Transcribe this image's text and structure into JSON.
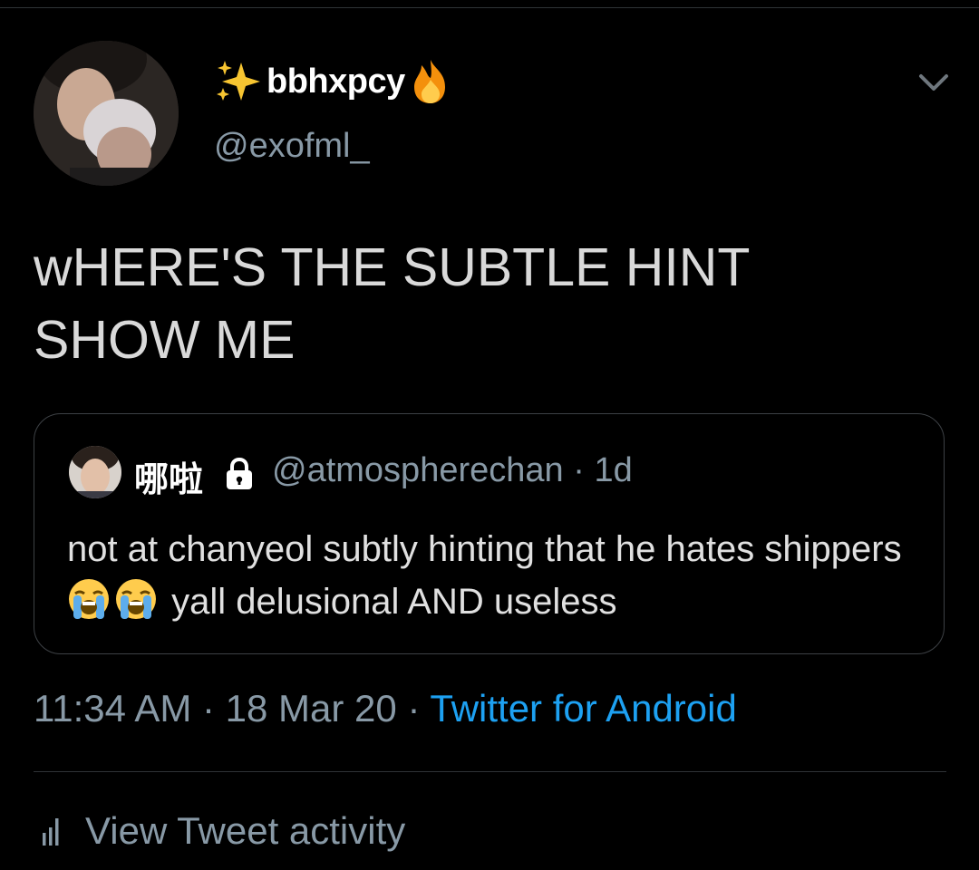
{
  "tweet": {
    "name_prefix_emoji": "sparkles",
    "display_name": "bbhxpcy",
    "name_suffix_emoji": "fire",
    "handle": "@exofml_",
    "text_line1": "wHERE'S THE SUBTLE HINT",
    "text_line2": "SHOW ME",
    "time": "11:34 AM",
    "date": "18 Mar 20",
    "source": "Twitter for Android"
  },
  "quote": {
    "display_name": "哪啦",
    "handle": "@atmospherechan",
    "age": "1d",
    "text_part1": "not at chanyeol subtly hinting that he hates shippers",
    "text_part2": "yall delusional AND useless",
    "emoji": "loudly-crying-face"
  },
  "footer": {
    "activity_label": "View Tweet activity"
  },
  "colors": {
    "background": "#000000",
    "link": "#1da1f2",
    "muted": "#8899a6"
  }
}
